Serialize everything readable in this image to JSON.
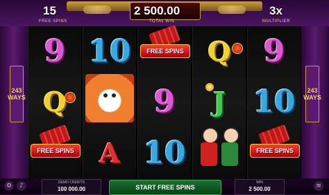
{
  "top": {
    "free_spins_value": "15",
    "free_spins_label": "FREE SPINS",
    "total_win_value": "2 500.00",
    "total_win_label": "TOTAL WIN",
    "multiplier_value": "3x",
    "multiplier_label": "MULTIPLIER"
  },
  "ways": [
    "243",
    "WAYS"
  ],
  "reels": [
    [
      "9",
      "Q",
      "FREE SPINS"
    ],
    [
      "10",
      "lion-dance",
      "A"
    ],
    [
      "FREE SPINS",
      "9",
      "10"
    ],
    [
      "Q",
      "J",
      "kids"
    ],
    [
      "9",
      "10",
      "FREE SPINS"
    ]
  ],
  "free_spins_badge": "FREE SPINS",
  "bottom": {
    "credits_label": "DEMO CREDITS",
    "credits_value": "100 000.00",
    "start_label": "START FREE SPINS",
    "win_label": "WIN",
    "win_value": "2 500.00"
  },
  "colors": {
    "frame": "#4a1560",
    "gold": "#c8a040",
    "nine": "#d85ad0",
    "ten": "#3aa8e0",
    "queen": "#f0d030",
    "jack": "#40c850",
    "ace": "#e03030",
    "start_button": "#1a7030"
  },
  "icons": [
    "dragon-icon",
    "lantern-icon",
    "coin-icon",
    "settings-icon",
    "sound-icon",
    "menu-icon"
  ]
}
